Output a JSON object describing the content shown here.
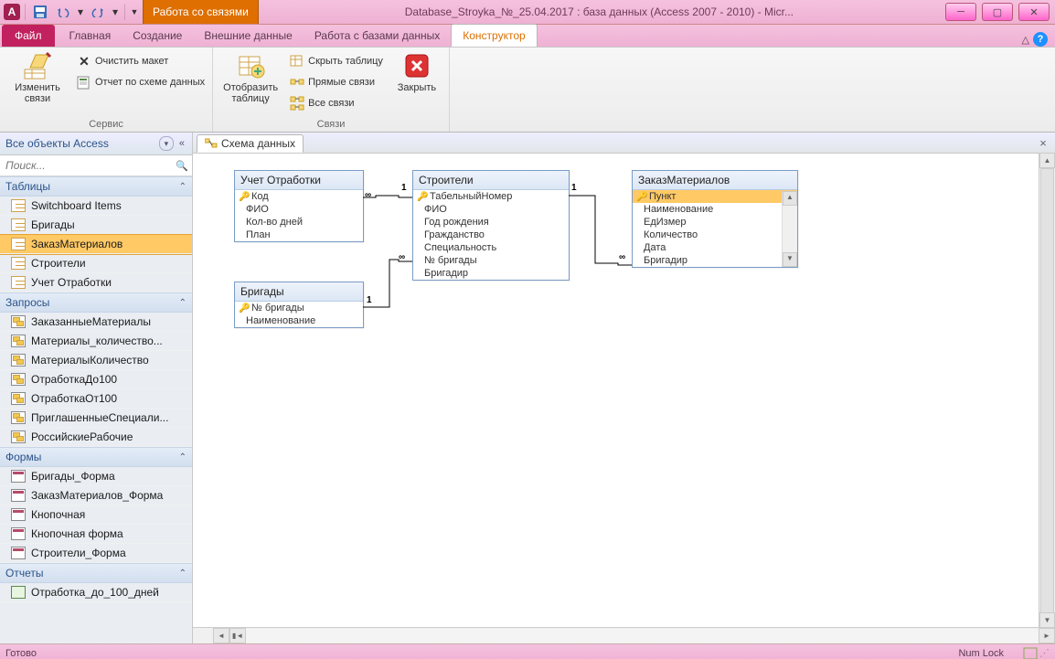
{
  "qat": {
    "app_letter": "A"
  },
  "title": {
    "contextual": "Работа со связями",
    "database": "Database_Stroyka_№_25.04.2017 : база данных (Access 2007 - 2010)  -  Micr..."
  },
  "tabs": {
    "file": "Файл",
    "items": [
      "Главная",
      "Создание",
      "Внешние данные",
      "Работа с базами данных",
      "Конструктор"
    ],
    "active_index": 4
  },
  "ribbon": {
    "group1": {
      "label": "Сервис",
      "edit_relations": "Изменить связи",
      "clear_layout": "Очистить макет",
      "relationship_report": "Отчет по схеме данных"
    },
    "group2": {
      "label": "Связи",
      "show_table": "Отобразить таблицу",
      "hide_table": "Скрыть таблицу",
      "direct_relations": "Прямые связи",
      "all_relations": "Все связи",
      "close": "Закрыть"
    }
  },
  "nav": {
    "header": "Все объекты Access",
    "search_placeholder": "Поиск...",
    "cats": {
      "tables": "Таблицы",
      "queries": "Запросы",
      "forms": "Формы",
      "reports": "Отчеты"
    },
    "tables": [
      "Switchboard Items",
      "Бригады",
      "ЗаказМатериалов",
      "Строители",
      "Учет Отработки"
    ],
    "tables_selected": 2,
    "queries": [
      "ЗаказанныеМатериалы",
      "Материалы_количество...",
      "МатериалыКоличество",
      "ОтработкаДо100",
      "ОтработкаОт100",
      "ПриглашенныеСпециали...",
      "РоссийскиеРабочие"
    ],
    "forms": [
      "Бригады_Форма",
      "ЗаказМатериалов_Форма",
      "Кнопочная",
      "Кнопочная форма",
      "Строители_Форма"
    ],
    "reports": [
      "Отработка_до_100_дней"
    ]
  },
  "doc": {
    "tab": "Схема данных"
  },
  "entities": {
    "e1": {
      "title": "Учет Отработки",
      "fields": [
        "ФИО",
        "Кол-во дней",
        "План"
      ],
      "key": "Код"
    },
    "e2": {
      "title": "Строители",
      "fields": [
        "ФИО",
        "Год рождения",
        "Гражданство",
        "Специальность",
        "№ бригады",
        "Бригадир"
      ],
      "key": "ТабельныйНомер"
    },
    "e3": {
      "title": "ЗаказМатериалов",
      "fields": [
        "Наименование",
        "ЕдИзмер",
        "Количество",
        "Дата",
        "Бригадир"
      ],
      "key": "Пункт"
    },
    "e4": {
      "title": "Бригады",
      "fields": [
        "Наименование"
      ],
      "key": "№ бригады"
    }
  },
  "rel_labels": {
    "one": "1",
    "inf": "∞"
  },
  "status": {
    "ready": "Готово",
    "numlock": "Num Lock"
  },
  "icons": {
    "search": "🔍"
  }
}
